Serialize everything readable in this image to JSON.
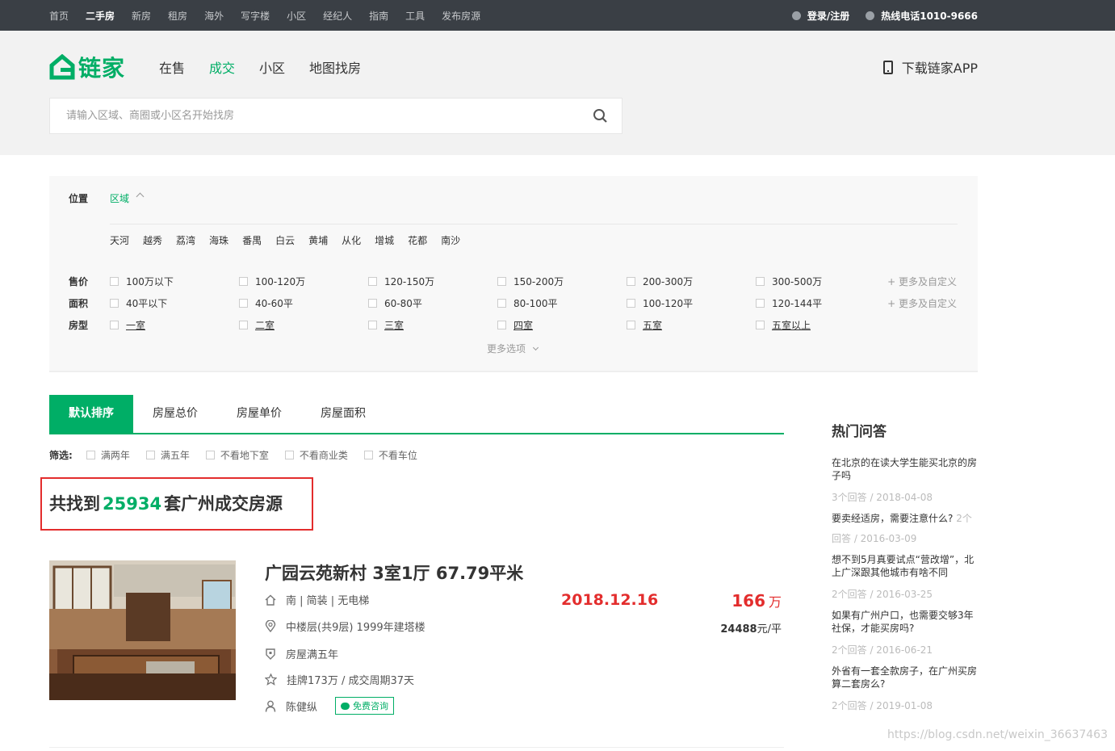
{
  "topbar": {
    "nav": [
      "首页",
      "二手房",
      "新房",
      "租房",
      "海外",
      "写字楼",
      "小区",
      "经纪人",
      "指南",
      "工具",
      "发布房源"
    ],
    "login": "登录/注册",
    "hotline": "热线电话1010-9666"
  },
  "header": {
    "logo_text": "链家",
    "nav": [
      "在售",
      "成交",
      "小区",
      "地图找房"
    ],
    "download": "下载链家APP",
    "search_placeholder": "请输入区域、商圈或小区名开始找房"
  },
  "filter": {
    "position_label": "位置",
    "region_tab": "区域",
    "districts": [
      "天河",
      "越秀",
      "荔湾",
      "海珠",
      "番禺",
      "白云",
      "黄埔",
      "从化",
      "增城",
      "花都",
      "南沙"
    ],
    "price_label": "售价",
    "price_options": [
      "100万以下",
      "100-120万",
      "120-150万",
      "150-200万",
      "200-300万",
      "300-500万"
    ],
    "area_label": "面积",
    "area_options": [
      "40平以下",
      "40-60平",
      "60-80平",
      "80-100平",
      "100-120平",
      "120-144平"
    ],
    "layout_label": "房型",
    "layout_options": [
      "一室",
      "二室",
      "三室",
      "四室",
      "五室",
      "五室以上"
    ],
    "more_custom": "+ 更多及自定义",
    "more_options": "更多选项"
  },
  "sort_tabs": [
    "默认排序",
    "房屋总价",
    "房屋单价",
    "房屋面积"
  ],
  "screen": {
    "label": "筛选:",
    "options": [
      "满两年",
      "满五年",
      "不看地下室",
      "不看商业类",
      "不看车位"
    ]
  },
  "total": {
    "prefix": "共找到",
    "count": "25934",
    "suffix": "套广州成交房源"
  },
  "listing": {
    "title": "广园云苑新村 3室1厅 67.79平米",
    "house_info": "南 | 简装 | 无电梯",
    "position_info": "中楼层(共9层) 1999年建塔楼",
    "tag": "房屋满五年",
    "deal_cycle": "挂牌173万 / 成交周期37天",
    "agent": "陈健纵",
    "consult": "免费咨询",
    "deal_date": "2018.12.16",
    "total_price": "166",
    "total_unit": "万",
    "unit_price_value": "24488",
    "unit_price_unit": "元/平"
  },
  "sidebar": {
    "title": "热门问答",
    "items": [
      {
        "q": "在北京的在读大学生能买北京的房子吗",
        "meta": "3个回答 / 2018-04-08"
      },
      {
        "q": "要卖经适房，需要注意什么?",
        "cnt": "2个",
        "meta": "回答 / 2016-03-09"
      },
      {
        "q": "想不到5月真要试点“营改增”，北上广深跟其他城市有啥不同",
        "meta": "2个回答 / 2016-03-25"
      },
      {
        "q": "如果有广州户口，也需要交够3年社保，才能买房吗?",
        "meta": "2个回答 / 2016-06-21"
      },
      {
        "q": "外省有一套全款房子，在广州买房算二套房么?",
        "meta": "2个回答 / 2019-01-08"
      }
    ]
  },
  "watermark": "https://blog.csdn.net/weixin_36637463",
  "colors": {
    "brand": "#00ae66",
    "price": "#e32d2d",
    "topbar": "#3a3f45"
  }
}
